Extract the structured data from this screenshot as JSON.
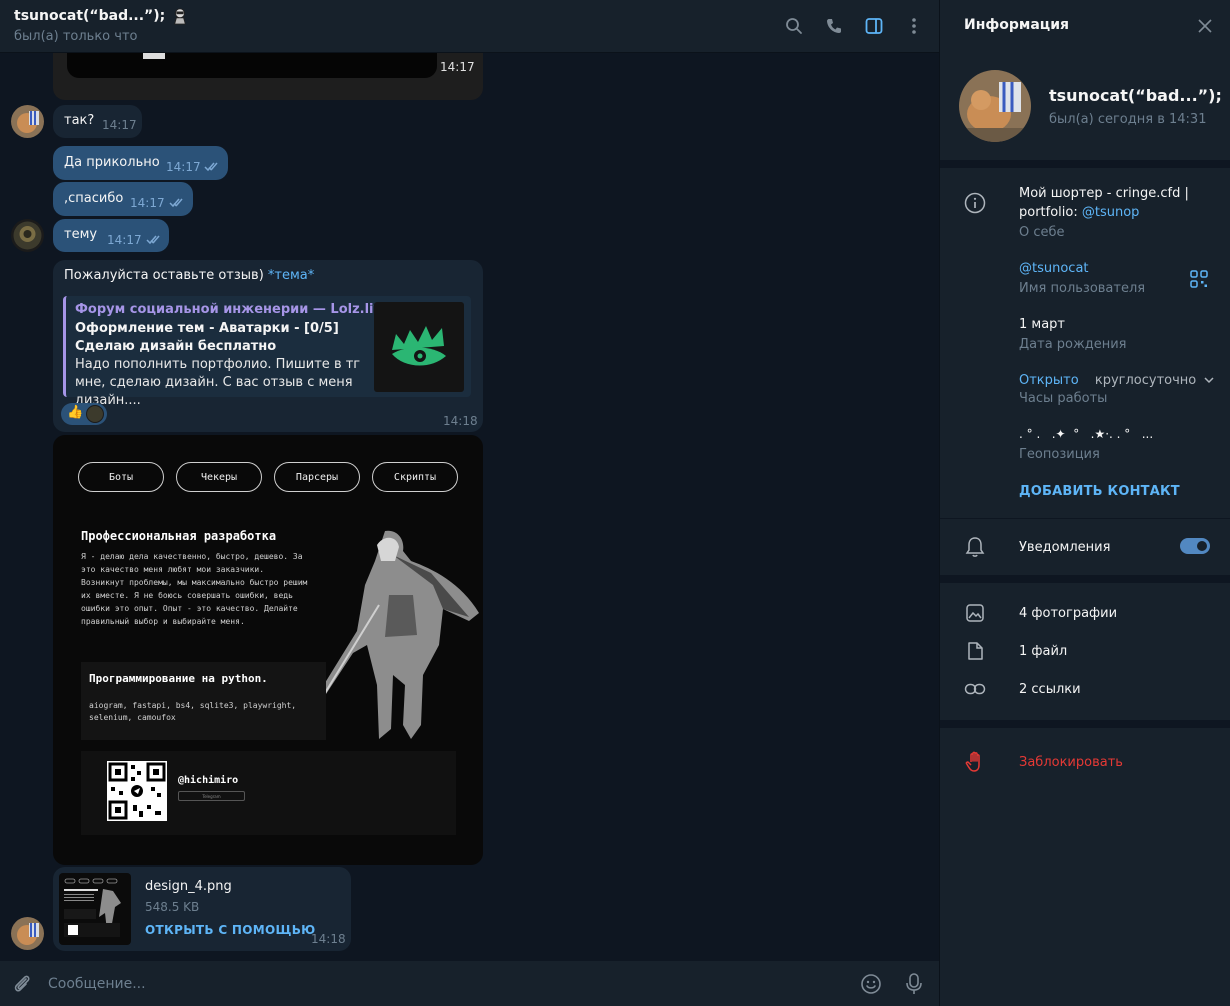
{
  "chat": {
    "title": "tsunocat(“bad...”);",
    "status": "был(а) только что",
    "header_icons": [
      "search-icon",
      "phone-icon",
      "sidebar-toggle-icon",
      "more-vertical-icon"
    ]
  },
  "messages": {
    "m0_time": "14:17",
    "m1_text": "так?",
    "m1_time": "14:17",
    "m2_text": "Да прикольно",
    "m2_time": "14:17",
    "m3_text": ",спасибо",
    "m3_time": "14:17",
    "m4_text": "тему",
    "m4_time": "14:17",
    "m5_text": "Пожалуйста оставьте отзыв)",
    "m5_link": "*тема*",
    "m5_time": "14:18",
    "preview_site": "Форум социальной инженерии — Lolz.live...",
    "preview_title": "Оформление тем - Аватарки - [0/5] Сделаю дизайн бесплатно",
    "preview_desc": "Надо пополнить портфолио. Пишите в тг мне, сделаю дизайн. С вас отзыв с меня дизайн....",
    "reaction_emoji": "👍"
  },
  "design": {
    "pills": [
      "Боты",
      "Чекеры",
      "Парсеры",
      "Скрипты"
    ],
    "heading": "Профессиональная разработка",
    "paragraph": "Я - делаю дела качественно, быстро, дешево. За это качество меня любят мои заказчики. Возникнут проблемы, мы максимально быстро решим их вместе. Я не боюсь совершать ошибки, ведь ошибки это опыт. Опыт - это качество. Делайте правильный выбор и выбирайте меня.",
    "heading2": "Программирование на python.",
    "stack": "aiogram, fastapi, bs4, sqlite3, playwright, selenium, camoufox",
    "handle": "@hichimiro",
    "small_label": "Telegram"
  },
  "file": {
    "name": "design_4.png",
    "size": "548.5 KB",
    "open": "ОТКРЫТЬ С ПОМОЩЬЮ",
    "time": "14:18"
  },
  "composer": {
    "placeholder": "Сообщение..."
  },
  "info": {
    "title": "Информация",
    "name": "tsunocat(“bad...”);",
    "last_seen": "был(а) сегодня в 14:31",
    "bio_line1": "Мой шортер - cringe.cfd |",
    "bio_line2_prefix": "portfolio: ",
    "bio_link": "@tsunop",
    "bio_label": "О себе",
    "username": "@tsunocat",
    "username_label": "Имя пользователя",
    "birthday": "1 март",
    "birthday_label": "Дата рождения",
    "hours_open": "Открыто",
    "hours_value": "круглосуточно",
    "hours_label": "Часы работы",
    "geo_value": ". ° .   .✦  °   .★·. . °   ...",
    "geo_label": "Геопозиция",
    "add_contact": "ДОБАВИТЬ КОНТАКТ",
    "notifications": "Уведомления",
    "notifications_on": true,
    "photos": "4 фотографии",
    "files": "1 файл",
    "links": "2 ссылки",
    "block": "Заблокировать"
  },
  "colors": {
    "background": "#0e1621",
    "panel": "#17212b",
    "bubble_in": "#182533",
    "bubble_out": "#2b5278",
    "accent": "#5eb5f7",
    "preview_accent": "#a695e7",
    "danger": "#e53935"
  }
}
